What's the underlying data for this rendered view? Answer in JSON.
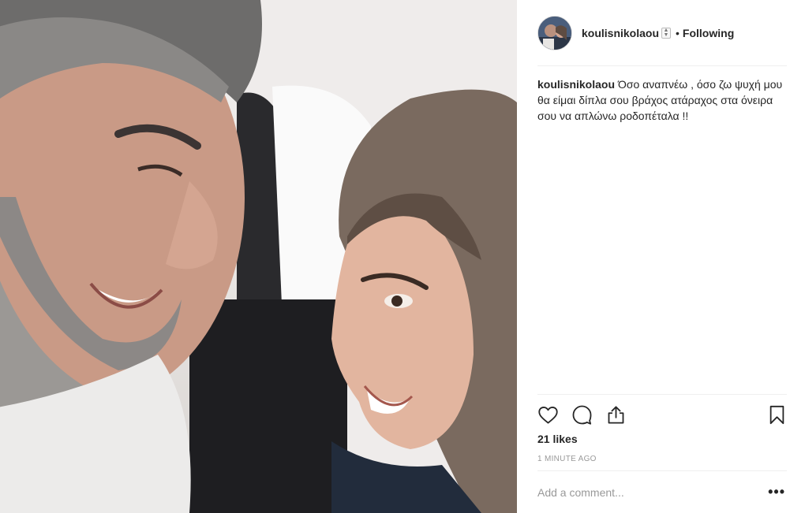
{
  "post": {
    "username": "koulisnikolaou",
    "follow_status": "Following",
    "separator": "•",
    "caption_user": "koulisnikolaou",
    "caption_text": "Όσο αναπνέω , όσο ζω ψυχή μου θα είμαι δίπλα σου βράχος ατάραχος στα όνειρα σου να απλώνω ροδοπέταλα !!",
    "likes": "21 likes",
    "time_ago": "1 MINUTE AGO",
    "comment_placeholder": "Add a comment...",
    "more_label": "•••"
  },
  "icons": {
    "like": "heart-icon",
    "comment": "comment-icon",
    "share": "share-icon",
    "save": "bookmark-icon"
  },
  "colors": {
    "text": "#262626",
    "muted": "#999999",
    "divider": "#efefef"
  }
}
